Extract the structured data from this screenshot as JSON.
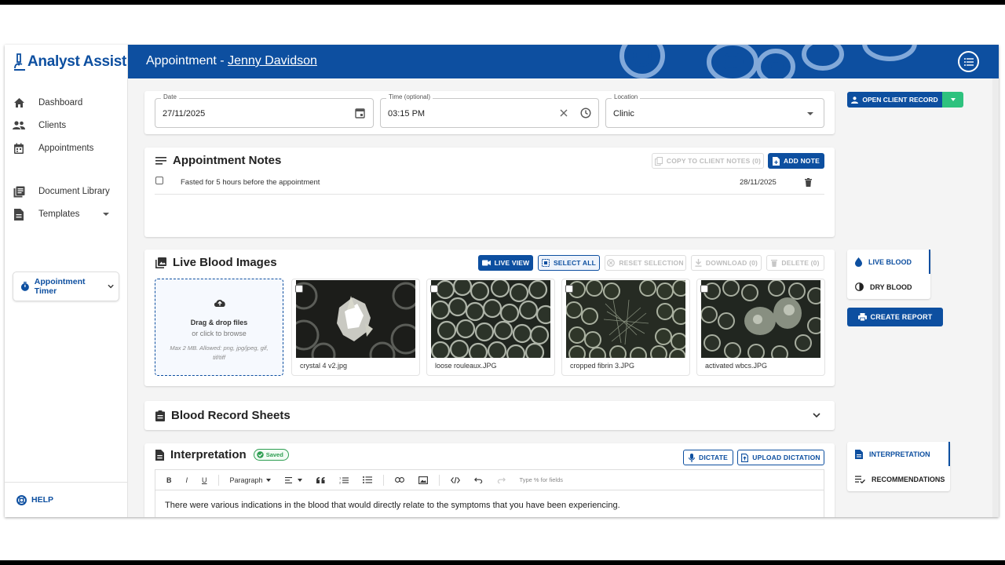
{
  "app": {
    "name": "Analyst Assist"
  },
  "sidebar": {
    "items": [
      {
        "label": "Dashboard",
        "icon": "home-icon"
      },
      {
        "label": "Clients",
        "icon": "people-icon"
      },
      {
        "label": "Appointments",
        "icon": "calendar-icon"
      },
      {
        "label": "Document Library",
        "icon": "library-icon"
      },
      {
        "label": "Templates",
        "icon": "document-icon"
      }
    ],
    "timer_label": "Appointment Timer",
    "help_label": "HELP"
  },
  "header": {
    "prefix": "Appointment - ",
    "client_name": "Jenny Davidson"
  },
  "details": {
    "date": {
      "label": "Date",
      "value": "27/11/2025"
    },
    "time": {
      "label": "Time (optional)",
      "value": "03:15 PM"
    },
    "location": {
      "label": "Location",
      "value": "Clinic"
    }
  },
  "notes": {
    "title": "Appointment Notes",
    "copy_label": "COPY TO CLIENT NOTES (0)",
    "add_label": "ADD NOTE",
    "items": [
      {
        "text": "Fasted for 5 hours before the appointment",
        "date": "28/11/2025"
      }
    ]
  },
  "images": {
    "title": "Live Blood Images",
    "live_view": "LIVE VIEW",
    "select_all": "SELECT ALL",
    "reset": "RESET SELECTION",
    "download": "DOWNLOAD (0)",
    "delete": "DELETE (0)",
    "dropzone": {
      "title": "Drag & drop files",
      "subtitle": "or click to browse",
      "hint": "Max 2 MB. Allowed: png, jpg/jpeg, gif, tif/tiff"
    },
    "files": [
      {
        "name": "crystal 4 v2.jpg"
      },
      {
        "name": "loose rouleaux.JPG"
      },
      {
        "name": "cropped fibrin 3.JPG"
      },
      {
        "name": "activated wbcs.JPG"
      }
    ]
  },
  "record_sheets": {
    "title": "Blood Record Sheets"
  },
  "interpretation": {
    "title": "Interpretation",
    "status": "Saved",
    "dictate": "DICTATE",
    "upload": "UPLOAD DICTATION",
    "toolbar": {
      "bold": "B",
      "italic": "I",
      "underline": "U",
      "paragraph": "Paragraph",
      "placeholder": "Type % for fields"
    },
    "body": "There were various indications in the blood that would directly relate to the symptoms that you have been experiencing."
  },
  "right": {
    "open_client": "OPEN CLIENT RECORD",
    "blood_tabs": [
      "LIVE BLOOD",
      "DRY BLOOD"
    ],
    "create_report": "CREATE REPORT",
    "report_tabs": [
      "INTERPRETATION",
      "RECOMMENDATIONS"
    ]
  },
  "colors": {
    "primary": "#0d4fa0",
    "success": "#2e9e52",
    "accent": "#2ec27e"
  }
}
